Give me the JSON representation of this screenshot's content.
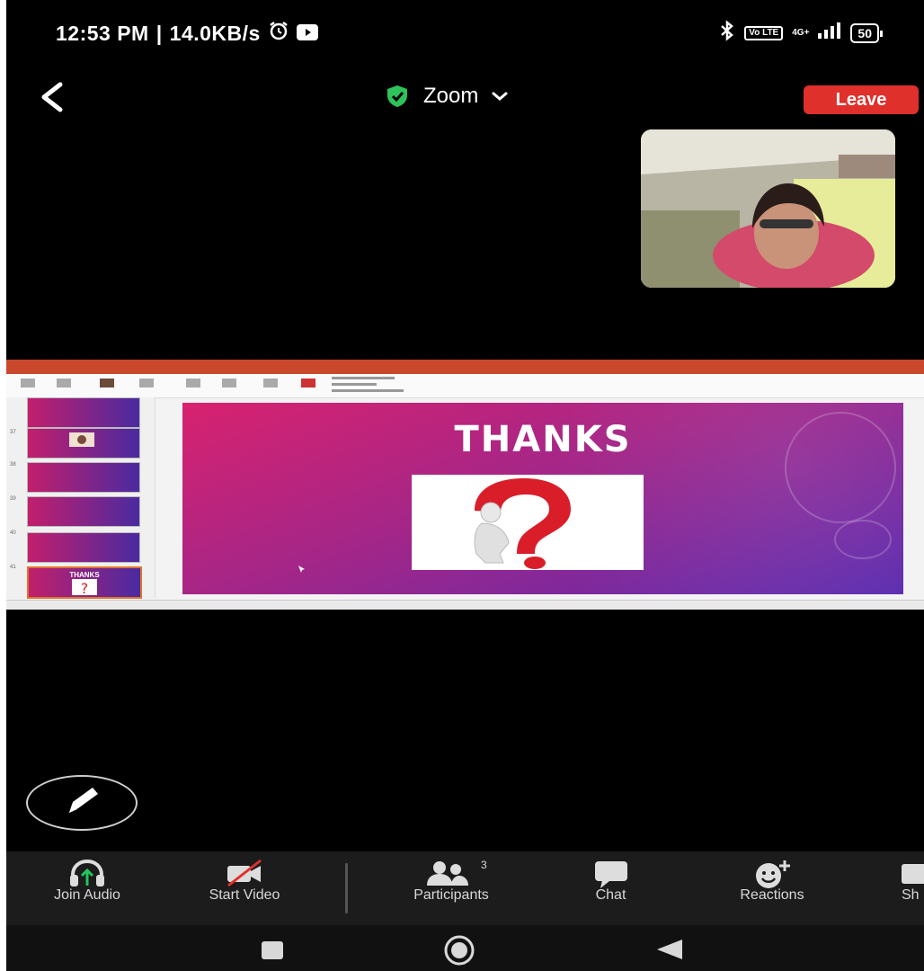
{
  "status_bar": {
    "time": "12:53 PM",
    "separator": "|",
    "speed": "14.0KB/s",
    "volte": "Vo LTE",
    "network": "4G+",
    "battery": "50"
  },
  "header": {
    "meeting_name": "Zoom",
    "leave_label": "Leave"
  },
  "shared_slide": {
    "title": "THANKS",
    "thumbnails": [
      {
        "num": "",
        "label": ""
      },
      {
        "num": "37",
        "label": ""
      },
      {
        "num": "38",
        "label": ""
      },
      {
        "num": "39",
        "label": ""
      },
      {
        "num": "40",
        "label": ""
      },
      {
        "num": "41",
        "label": "THANKS"
      }
    ]
  },
  "toolbar": {
    "join_audio": "Join Audio",
    "start_video": "Start Video",
    "participants": "Participants",
    "participants_count": "3",
    "chat": "Chat",
    "reactions": "Reactions",
    "share": "Sh"
  },
  "colors": {
    "leave": "#e0302b",
    "shield": "#2fc25b",
    "audio_arrow": "#22c55e",
    "video_off": "#e0302b",
    "slide_start": "#d8226f",
    "slide_end": "#5a2bb0"
  }
}
